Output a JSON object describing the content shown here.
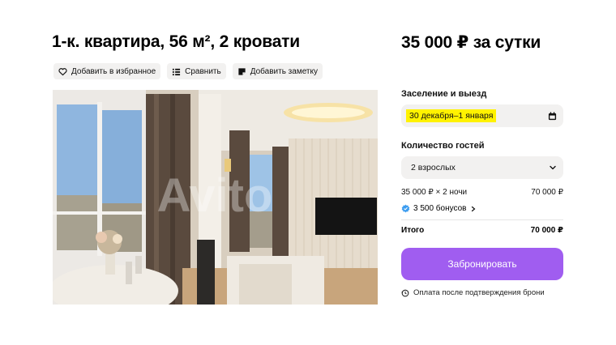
{
  "listing": {
    "title": "1-к. квартира, 56 м², 2 кровати",
    "price": "35 000 ₽ за сутки"
  },
  "actions": {
    "favorite": {
      "label": "Добавить в избранное",
      "icon": "heart-icon"
    },
    "compare": {
      "label": "Сравнить",
      "icon": "compare-icon"
    },
    "note": {
      "label": "Добавить заметку",
      "icon": "note-icon"
    }
  },
  "photo": {
    "watermark": "Avito"
  },
  "booking": {
    "dates_label": "Заселение и выезд",
    "dates_value": "30 декабря–1 января",
    "guests_label": "Количество гостей",
    "guests_value": "2 взрослых",
    "nights_line": "35 000 ₽ × 2 ночи",
    "nights_total": "70 000 ₽",
    "bonus": "3 500 бонусов",
    "total_label": "Итого",
    "total_value": "70 000 ₽",
    "book_button": "Забронировать",
    "payment_note": "Оплата после подтверждения брони"
  },
  "colors": {
    "accent": "#a05df0",
    "highlight": "#fff200",
    "chip_bg": "#f2f1f0",
    "bonus_icon": "#3b9cf0"
  }
}
